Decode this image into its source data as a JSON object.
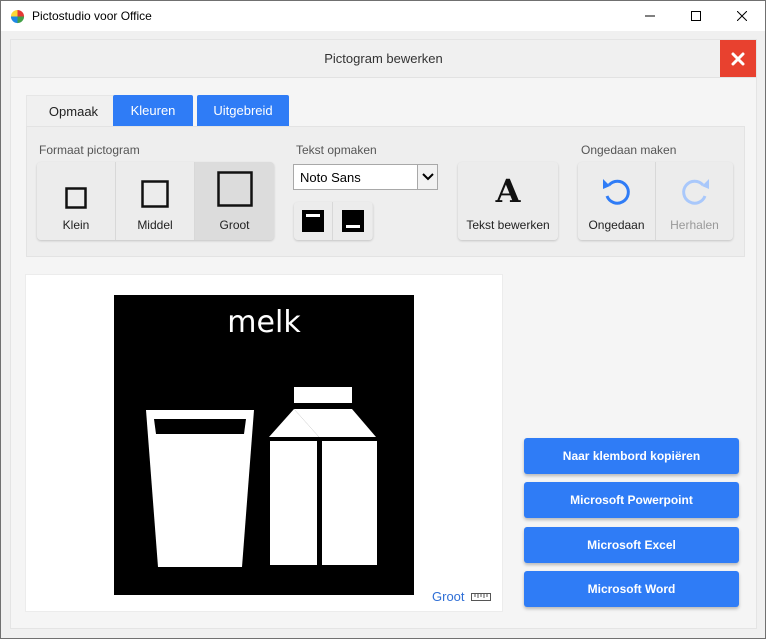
{
  "window": {
    "title": "Pictostudio voor Office"
  },
  "dialog": {
    "title": "Pictogram bewerken"
  },
  "tabs": [
    {
      "label": "Opmaak"
    },
    {
      "label": "Kleuren"
    },
    {
      "label": "Uitgebreid"
    }
  ],
  "ribbon": {
    "format": {
      "label": "Formaat pictogram",
      "buttons": [
        {
          "label": "Klein"
        },
        {
          "label": "Middel"
        },
        {
          "label": "Groot"
        }
      ],
      "selected": "Groot"
    },
    "text": {
      "label": "Tekst opmaken",
      "font": "Noto Sans",
      "edit_label": "Tekst bewerken",
      "edit_icon": "A"
    },
    "undo": {
      "label": "Ongedaan maken",
      "undo_label": "Ongedaan",
      "redo_label": "Herhalen"
    }
  },
  "picto": {
    "word": "melk",
    "size_label": "Groot"
  },
  "actions": [
    {
      "label": "Naar klembord kopiëren"
    },
    {
      "label": "Microsoft Powerpoint"
    },
    {
      "label": "Microsoft Excel"
    },
    {
      "label": "Microsoft Word"
    }
  ],
  "colors": {
    "accent": "#2f7cf6",
    "close": "#e8412f",
    "picto_bg": "#000000",
    "picto_fg": "#ffffff"
  }
}
